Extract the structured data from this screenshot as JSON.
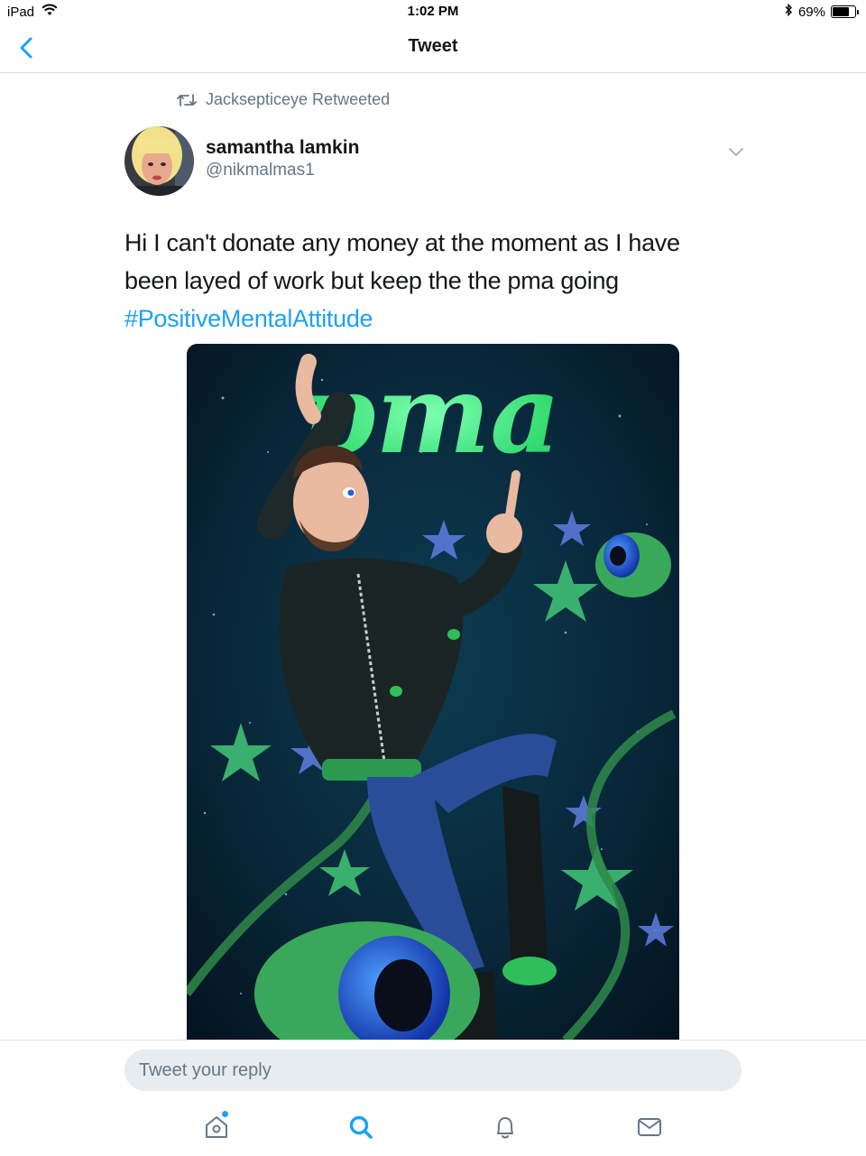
{
  "status_bar": {
    "device": "iPad",
    "time": "1:02 PM",
    "battery": "69%",
    "battery_level": 0.69
  },
  "nav": {
    "title": "Tweet"
  },
  "tweet": {
    "retweet_context": "Jacksepticeye Retweeted",
    "author": {
      "name": "samantha lamkin",
      "handle": "@nikmalmas1"
    },
    "text_line1": "Hi I can't donate any money at the moment as I have",
    "text_line2": "been layed of work but keep the the pma going",
    "hashtag": "#PositiveMentalAttitude",
    "media_text": "pma"
  },
  "reply": {
    "placeholder": "Tweet your reply"
  },
  "tabs": [
    {
      "name": "home",
      "icon": "home-icon"
    },
    {
      "name": "search",
      "icon": "search-icon"
    },
    {
      "name": "notifications",
      "icon": "bell-icon"
    },
    {
      "name": "messages",
      "icon": "mail-icon"
    }
  ],
  "colors": {
    "accent": "#1da1f2",
    "secondary_text": "#657786",
    "primary_text": "#14171a"
  }
}
